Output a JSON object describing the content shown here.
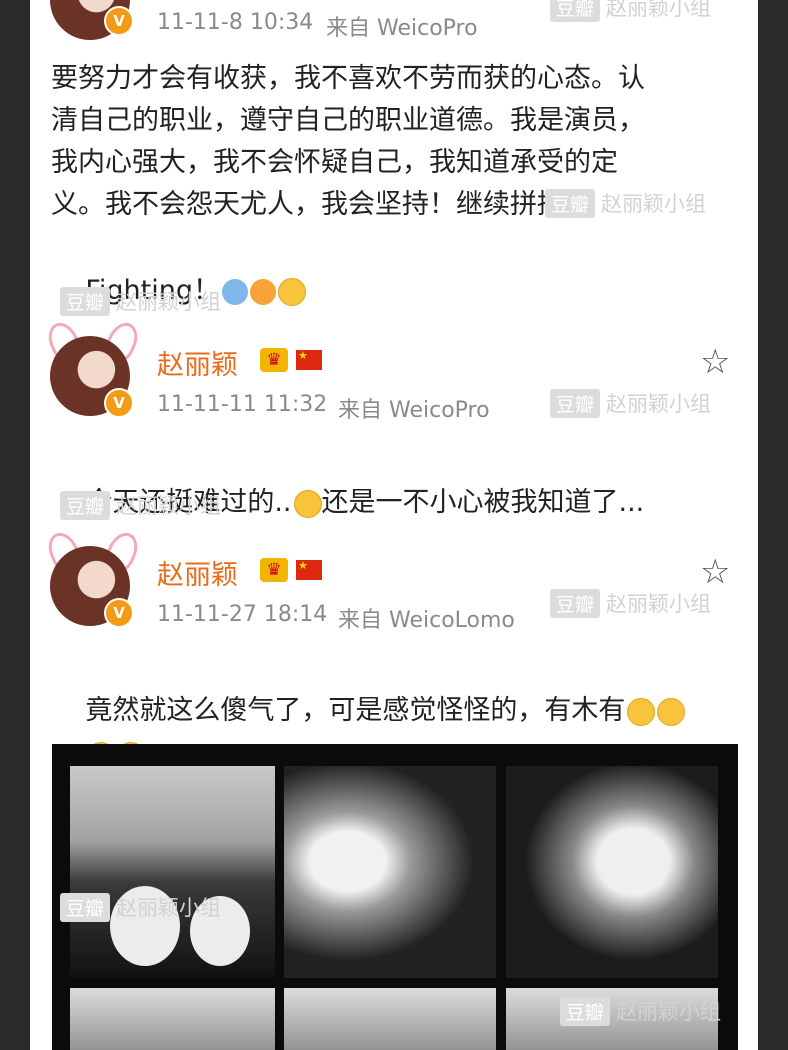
{
  "post1": {
    "date": "11-11-8 10:34",
    "source": "来自 WeicoPro",
    "lines": [
      "要努力才会有收获，我不喜欢不劳而获的心态。认",
      "清自己的职业，遵守自己的职业道德。我是演员，",
      "我内心强大，我不会怀疑自己，我知道承受的定",
      "义。我不会怨天尤人，我会坚持！继续拼搏！",
      "Fighting！"
    ]
  },
  "post2": {
    "name": "赵丽颖",
    "date": "11-11-11 11:32",
    "source": "来自 WeicoPro",
    "text_a": "今天还挺难过的..",
    "text_b": "还是一不小心被我知道了..."
  },
  "post3": {
    "name": "赵丽颖",
    "date": "11-11-27 18:14",
    "source": "来自 WeicoLomo",
    "text": "竟然就这么傻气了，可是感觉怪怪的，有木有"
  },
  "watermark": {
    "box": "豆瓣",
    "label": "赵丽颖小组"
  },
  "badges": {
    "verified": "V",
    "crown": "♛"
  },
  "icons": {
    "star": "star-outline-icon",
    "flag": "china-flag-icon"
  }
}
